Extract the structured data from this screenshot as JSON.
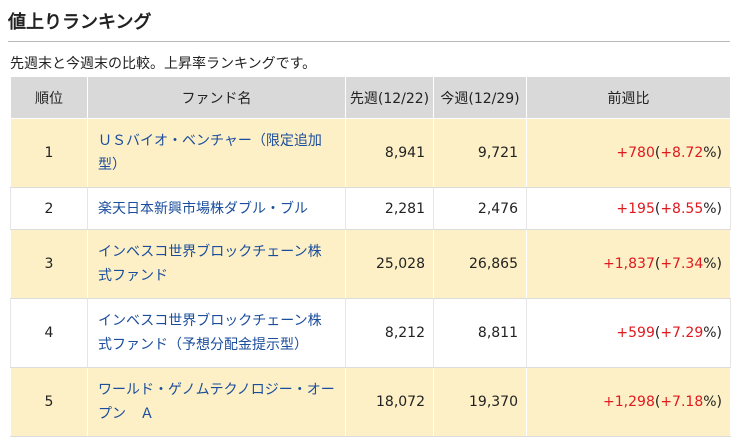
{
  "heading": "値上りランキング",
  "description": "先週末と今週末の比較。上昇率ランキングです。",
  "columns": {
    "rank": "順位",
    "fund": "ファンド名",
    "prev": "先週(12/22)",
    "curr": "今週(12/29)",
    "change": "前週比"
  },
  "rows": [
    {
      "rank": "1",
      "fund": "ＵＳバイオ・ベンチャー（限定追加型）",
      "prev": "8,941",
      "curr": "9,721",
      "change_abs": "+780",
      "change_pct": "+8.72",
      "pct_suffix": "%)"
    },
    {
      "rank": "2",
      "fund": "楽天日本新興市場株ダブル・ブル",
      "prev": "2,281",
      "curr": "2,476",
      "change_abs": "+195",
      "change_pct": "+8.55",
      "pct_suffix": "%)"
    },
    {
      "rank": "3",
      "fund": "インベスコ世界ブロックチェーン株式ファンド",
      "prev": "25,028",
      "curr": "26,865",
      "change_abs": "+1,837",
      "change_pct": "+7.34",
      "pct_suffix": "%)"
    },
    {
      "rank": "4",
      "fund": "インベスコ世界ブロックチェーン株式ファンド（予想分配金提示型）",
      "prev": "8,212",
      "curr": "8,811",
      "change_abs": "+599",
      "change_pct": "+7.29",
      "pct_suffix": "%)"
    },
    {
      "rank": "5",
      "fund": "ワールド・ゲノムテクノロジー・オープン　Ａ",
      "prev": "18,072",
      "curr": "19,370",
      "change_abs": "+1,298",
      "change_pct": "+7.18",
      "pct_suffix": "%)"
    }
  ],
  "colors": {
    "header_bg": "#d9d9d9",
    "odd_row_bg": "#fdf0c6",
    "link": "#1a4d9c",
    "positive": "#e0191e"
  }
}
